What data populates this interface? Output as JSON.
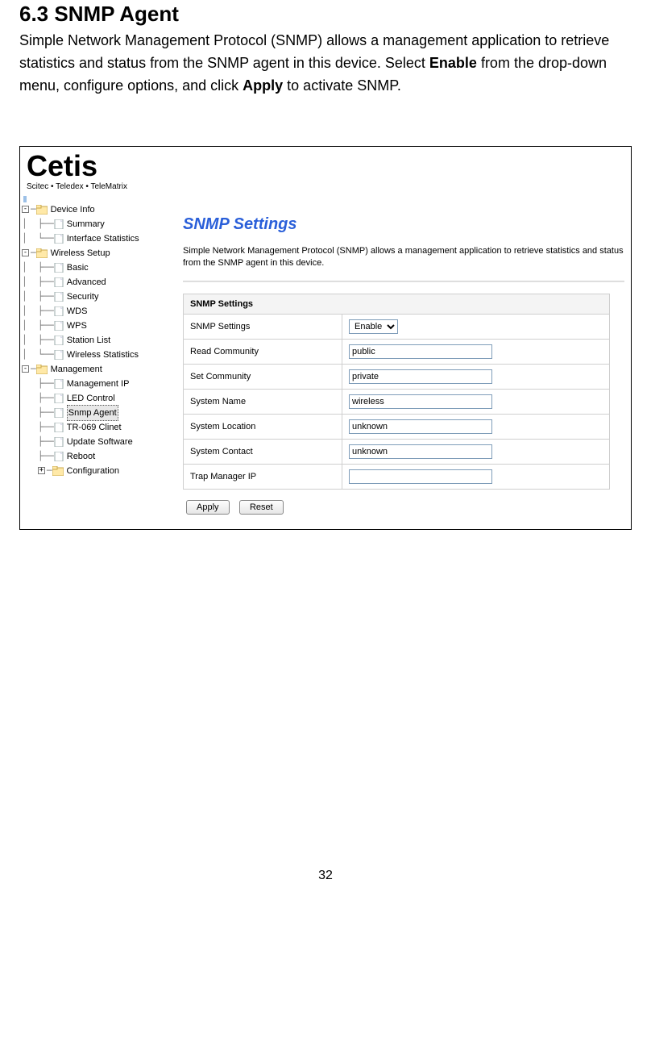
{
  "doc": {
    "heading": "6.3 SNMP Agent",
    "para_parts": {
      "p1": "Simple Network Management Protocol (SNMP) allows a management application to retrieve statistics and status from the SNMP agent in this device.  Select ",
      "b1": "Enable",
      "p2": " from the drop-down menu, configure options, and click ",
      "b2": "Apply",
      "p3": " to activate SNMP."
    },
    "page_number": "32"
  },
  "logo": {
    "main": "Cetis",
    "sub": "Scitec • Teledex • TeleMatrix"
  },
  "nav": {
    "device_info": "Device Info",
    "summary": "Summary",
    "interface_stats": "Interface Statistics",
    "wireless_setup": "Wireless Setup",
    "basic": "Basic",
    "advanced": "Advanced",
    "security": "Security",
    "wds": "WDS",
    "wps": "WPS",
    "station_list": "Station List",
    "wireless_stats": "Wireless Statistics",
    "management": "Management",
    "management_ip": "Management IP",
    "led_control": "LED Control",
    "snmp_agent": "Snmp Agent",
    "tr069": "TR-069 Clinet",
    "update_sw": "Update Software",
    "reboot": "Reboot",
    "configuration": "Configuration"
  },
  "content": {
    "title": "SNMP Settings",
    "description": "Simple Network Management Protocol (SNMP) allows a management application to retrieve statistics and status from the SNMP agent in this device.",
    "table_header": "SNMP Settings",
    "rows": {
      "snmp_settings_label": "SNMP Settings",
      "snmp_settings_value": "Enable",
      "read_community_label": "Read Community",
      "read_community_value": "public",
      "set_community_label": "Set Community",
      "set_community_value": "private",
      "system_name_label": "System Name",
      "system_name_value": "wireless",
      "system_location_label": "System Location",
      "system_location_value": "unknown",
      "system_contact_label": "System Contact",
      "system_contact_value": "unknown",
      "trap_manager_label": "Trap Manager IP",
      "trap_manager_value": ""
    },
    "buttons": {
      "apply": "Apply",
      "reset": "Reset"
    }
  }
}
